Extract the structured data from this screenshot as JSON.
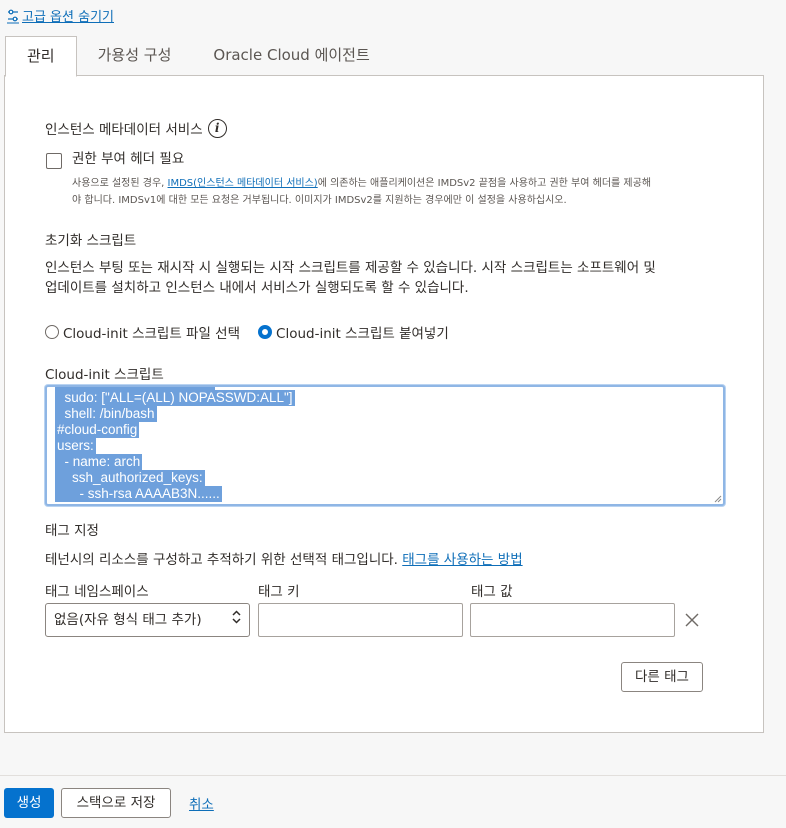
{
  "advanced_toggle": {
    "label": "고급 옵션 숨기기"
  },
  "tabs": [
    {
      "label": "관리",
      "active": true
    },
    {
      "label": "가용성 구성",
      "active": false
    },
    {
      "label": "Oracle Cloud 에이전트",
      "active": false
    }
  ],
  "imds": {
    "heading": "인스턴스 메타데이터 서비스",
    "checkbox_label": "권한 부여 헤더 필요",
    "checked": false,
    "desc_prefix": "사용으로 설정된 경우, ",
    "desc_link": "IMDS(인스턴스 메타데이터 서비스)",
    "desc_line1_suffix": "에 의존하는 애플리케이션은 IMDSv2 끝점을 사용하고 권한 부여 헤더를 제공해",
    "desc_line2": "야 합니다. IMDSv1에 대한 모든 요청은 거부됩니다. 이미지가 IMDSv2를 지원하는 경우에만 이 설정을 사용하십시오."
  },
  "init_script": {
    "heading": "초기화 스크립트",
    "desc_line1": "인스턴스 부팅 또는 재시작 시 실행되는 시작 스크립트를 제공할 수 있습니다. 시작 스크립트는 소프트웨어 및",
    "desc_line2": "업데이트를 설치하고 인스턴스 내에서 서비스가 실행되도록 할 수 있습니다.",
    "option_file": "Cloud-init 스크립트 파일 선택",
    "option_paste": "Cloud-init 스크립트 붙여넣기",
    "selected": "paste",
    "field_label": "Cloud-init 스크립트",
    "lines": [
      "  sudo: [\"ALL=(ALL) NOPASSWD:ALL\"]",
      "  shell: /bin/bash",
      "#cloud-config",
      "users:",
      "  - name: arch",
      "    ssh_authorized_keys:",
      "      - ssh-rsa AAAAB3N......"
    ]
  },
  "tagging": {
    "heading": "태그 지정",
    "desc": "테넌시의 리소스를 구성하고 추적하기 위한 선택적 태그입니다. ",
    "desc_link": "태그를 사용하는 방법",
    "namespace_label": "태그 네임스페이스",
    "namespace_value": "없음(자유 형식 태그 추가)",
    "key_label": "태그 키",
    "key_value": "",
    "value_label": "태그 값",
    "value_value": "",
    "another_tag": "다른 태그"
  },
  "footer": {
    "create": "생성",
    "save_stack": "스택으로 저장",
    "cancel": "취소"
  }
}
